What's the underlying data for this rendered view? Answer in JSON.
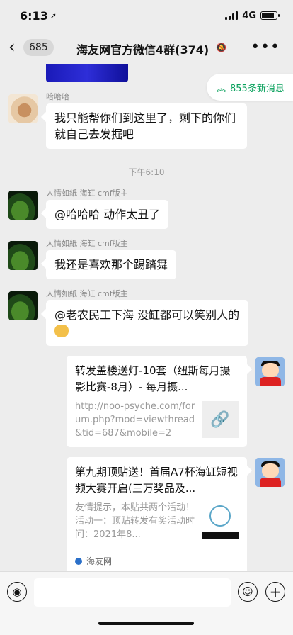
{
  "status": {
    "time": "6:13",
    "network": "4G",
    "battery_level": 0.85
  },
  "nav": {
    "back_count": "685",
    "title": "海友网官方微信4群(374)"
  },
  "new_messages": {
    "label": "855条新消息"
  },
  "messages": [
    {
      "sender": "哈哈哈",
      "text": "我只能帮你们到这里了，剩下的你们就自己去发掘吧"
    },
    {
      "timestamp": "下午6:10"
    },
    {
      "sender": "人情如紙 海缸 cmf版主",
      "text": "@哈哈哈 动作太丑了"
    },
    {
      "sender": "人情如紙 海缸 cmf版主",
      "text": "我还是喜欢那个踢踏舞"
    },
    {
      "sender": "人情如紙 海缸 cmf版主",
      "text": "@老农民工下海 没缸都可以笑别人的"
    }
  ],
  "link_cards": [
    {
      "title": "转发盖楼送灯-10套（纽斯每月摄影比赛-8月）- 每月摄...",
      "desc": "http://noo-psyche.com/forum.php?mod=viewthread&tid=687&mobile=2"
    },
    {
      "title": "第九期顶贴送！首届A7杯海缸短视频大赛开启(三万奖品及...",
      "desc": "友情提示，本贴共两个活动！活动一：顶贴转发有奖活动时间：2021年8...",
      "source": "海友网"
    }
  ]
}
